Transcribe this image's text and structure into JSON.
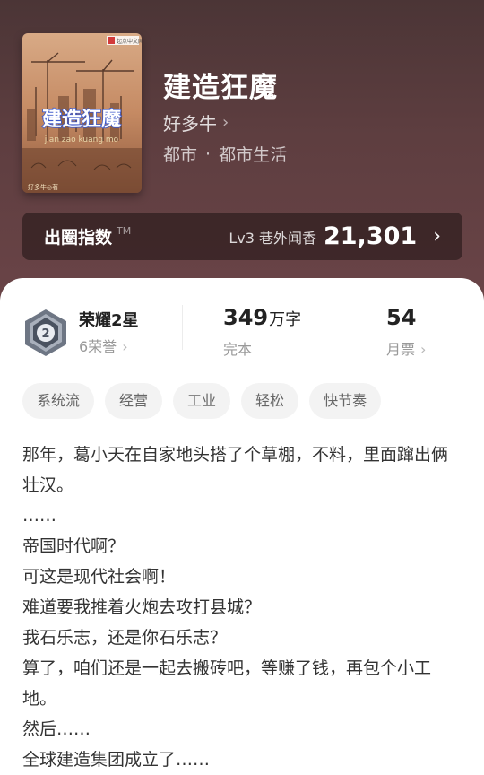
{
  "book": {
    "title": "建造狂魔",
    "author": "好多牛",
    "genre": "都市",
    "subgenre": "都市生活",
    "separator": "·",
    "cover": {
      "title_art": "建造狂魔",
      "pinyin": "jian zao kuang mo",
      "publisher": "起点中文网",
      "author_stamp": "好多牛◎著"
    }
  },
  "index_bar": {
    "label": "出圈指数",
    "tm": "TM",
    "level": "Lv3 巷外闻香",
    "value": "21,301"
  },
  "stats": {
    "honor_title": "荣耀2星",
    "honor_count": "6荣誉",
    "badge_number": "2",
    "word_count": "349",
    "word_unit": "万字",
    "status": "完本",
    "monthly_tickets": "54",
    "tickets_label": "月票"
  },
  "tags": [
    "系统流",
    "经营",
    "工业",
    "轻松",
    "快节奏"
  ],
  "synopsis": [
    "那年，葛小天在自家地头搭了个草棚，不料，里面蹿出俩壮汉。",
    "……",
    "帝国时代啊？",
    "可这是现代社会啊！",
    "难道要我推着火炮去攻打县城？",
    "我石乐志，还是你石乐志？",
    "算了，咱们还是一起去搬砖吧，等赚了钱，再包个小工地。",
    "然后……",
    "全球建造集团成立了……"
  ],
  "colors": {
    "hero_bg": "#5a3c3e",
    "text_dark": "#333333",
    "text_muted": "#999999",
    "tag_bg": "#f3f3f3"
  }
}
